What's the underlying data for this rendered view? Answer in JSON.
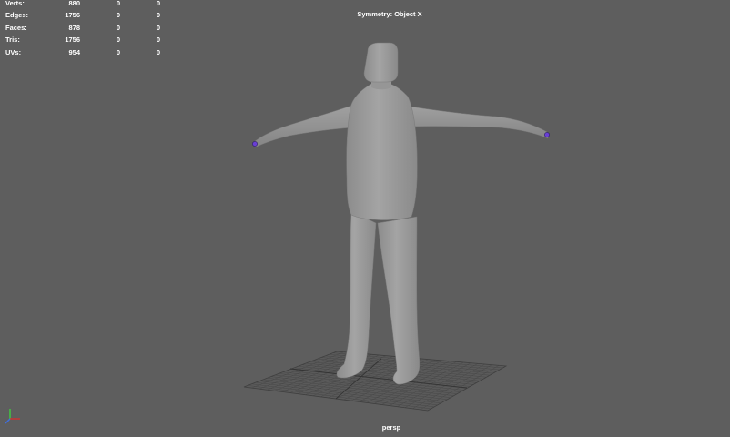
{
  "hud": {
    "rows": [
      {
        "label": "Verts:",
        "v1": "880",
        "v2": "0",
        "v3": "0"
      },
      {
        "label": "Edges:",
        "v1": "1756",
        "v2": "0",
        "v3": "0"
      },
      {
        "label": "Faces:",
        "v1": "878",
        "v2": "0",
        "v3": "0"
      },
      {
        "label": "Tris:",
        "v1": "1756",
        "v2": "0",
        "v3": "0"
      },
      {
        "label": "UVs:",
        "v1": "954",
        "v2": "0",
        "v3": "0"
      }
    ]
  },
  "symmetry_label": "Symmetry: Object X",
  "camera_label": "persp",
  "colors": {
    "background": "#5e5e5e",
    "mesh": "#9a9a9a",
    "grid": "#3a3a3a",
    "selection": "#6a3fd4",
    "axis_x": "#d23030",
    "axis_y": "#3fd03f",
    "axis_z": "#3f6fe0"
  },
  "icons": {
    "axis": "view-axis-icon"
  }
}
